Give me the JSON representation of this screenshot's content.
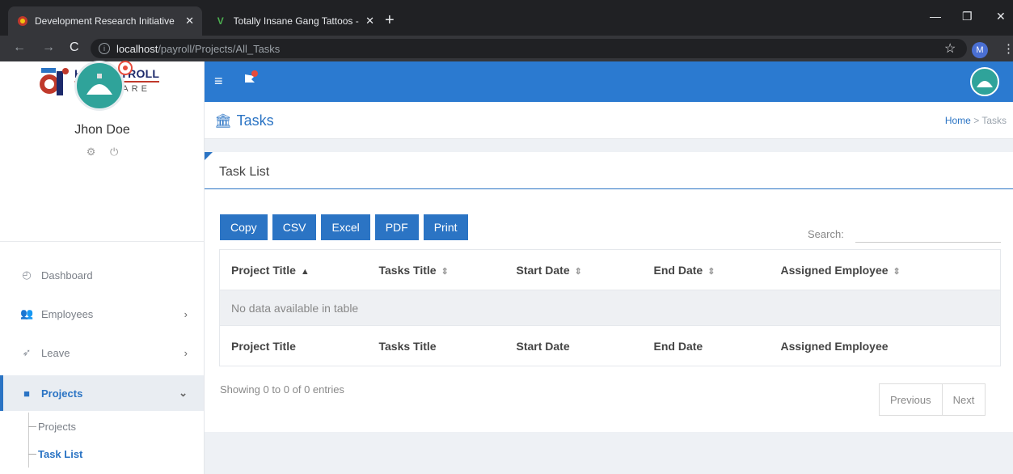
{
  "browser": {
    "tabs": [
      {
        "title": "Development Research Initiative",
        "favicon": "dri-favicon"
      },
      {
        "title": "Totally Insane Gang Tattoos - Vir",
        "favicon": "v-favicon"
      }
    ],
    "url_host": "localhost",
    "url_path": "/payroll/Projects/All_Tasks",
    "profile_initial": "M"
  },
  "brand": {
    "line1": "HR & PAYROLL",
    "line2": "SOFTWARE"
  },
  "user": {
    "name": "Jhon Doe"
  },
  "sidebar": {
    "items": [
      {
        "label": "Dashboard",
        "icon": "dashboard-icon"
      },
      {
        "label": "Employees",
        "icon": "users-icon"
      },
      {
        "label": "Leave",
        "icon": "rocket-icon"
      },
      {
        "label": "Projects",
        "icon": "briefcase-icon"
      }
    ],
    "sub_items": [
      {
        "label": "Projects"
      },
      {
        "label": "Task List"
      }
    ]
  },
  "page": {
    "title": "Tasks",
    "breadcrumb_home": "Home",
    "breadcrumb_current": "Tasks",
    "card_title": "Task List"
  },
  "toolbar": {
    "buttons": [
      "Copy",
      "CSV",
      "Excel",
      "PDF",
      "Print"
    ],
    "search_label": "Search:"
  },
  "table": {
    "columns": [
      "Project Title",
      "Tasks Title",
      "Start Date",
      "End Date",
      "Assigned Employee"
    ],
    "empty_message": "No data available in table",
    "info": "Showing 0 to 0 of 0 entries",
    "prev_label": "Previous",
    "next_label": "Next"
  },
  "colors": {
    "primary": "#2b7ad0",
    "accent": "#2b74c4"
  }
}
